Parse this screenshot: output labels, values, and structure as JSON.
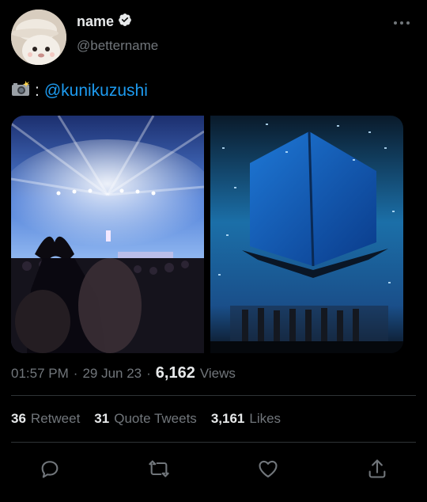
{
  "tweet": {
    "display_name": "name",
    "handle": "@bettername",
    "caption_colon": ":",
    "caption_mention": "@kunikuzushi",
    "time": "01:57 PM",
    "date": "29 Jun 23",
    "views_count": "6,162",
    "views_label": "Views",
    "retweets_count": "36",
    "retweets_label": "Retweet",
    "quotes_count": "31",
    "quotes_label": "Quote Tweets",
    "likes_count": "3,161",
    "likes_label": "Likes",
    "separator": "·"
  },
  "icons": {
    "verified": "verified-badge-icon",
    "more": "more-options-icon",
    "camera": "camera-flash-icon",
    "reply": "reply-icon",
    "retweet": "retweet-icon",
    "like": "heart-icon",
    "share": "share-icon"
  },
  "colors": {
    "background": "#000000",
    "text": "#e7e9ea",
    "secondary": "#71767b",
    "link": "#1d9bf0",
    "divider": "#2f3336"
  }
}
